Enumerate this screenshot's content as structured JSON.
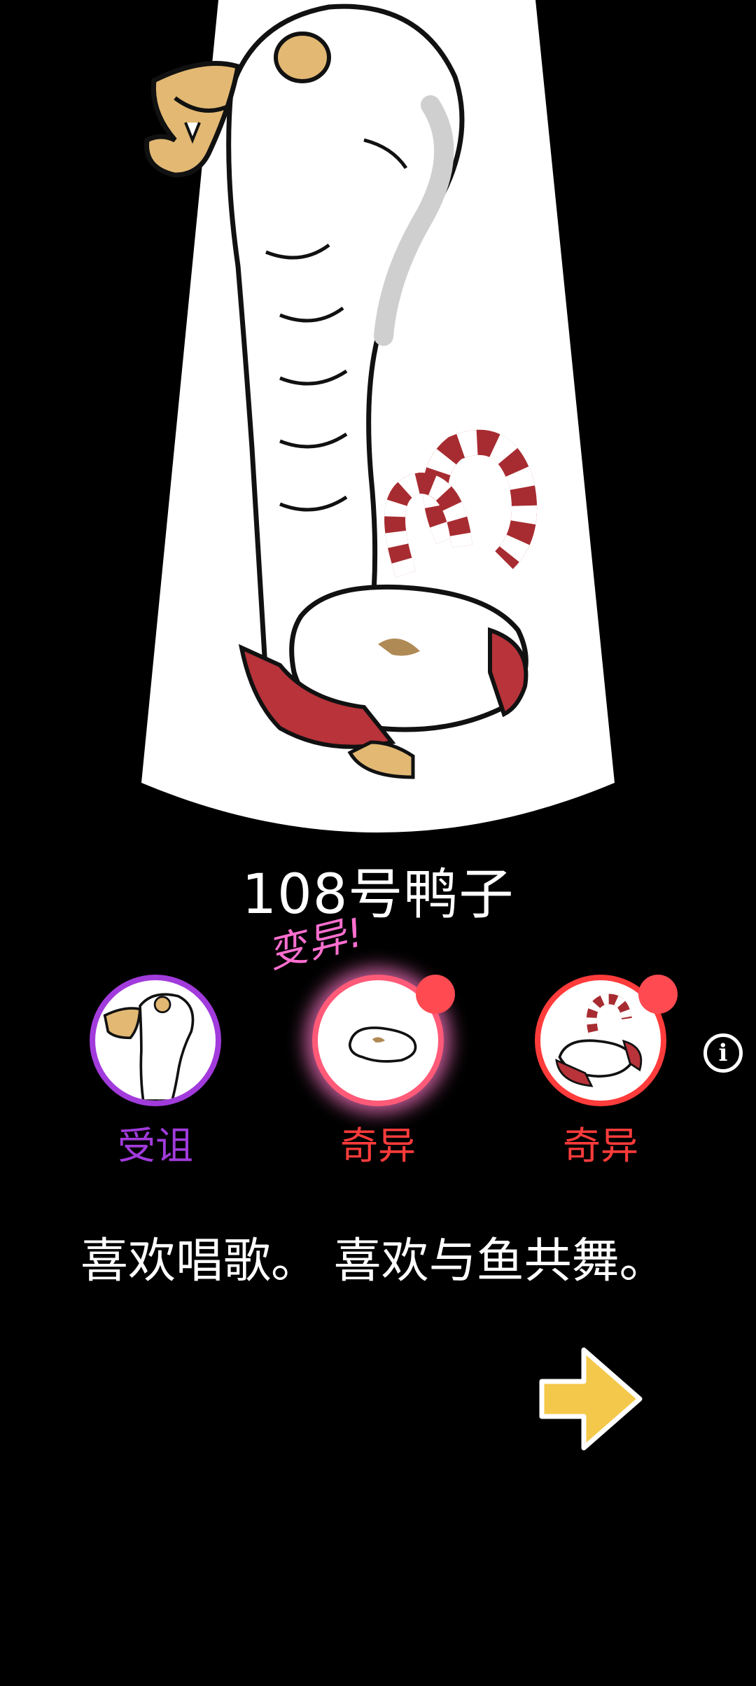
{
  "character": {
    "name": "108号鸭子",
    "mutation_label": "变异!",
    "description": "喜欢唱歌。 喜欢与鱼共舞。"
  },
  "traits": [
    {
      "label": "受诅",
      "color": "#a23bdc",
      "icon": "cursed-snake-neck-icon"
    },
    {
      "label": "奇异",
      "color": "#ff3b3b",
      "icon": "duck-body-icon",
      "glowing": true,
      "new": true
    },
    {
      "label": "奇异",
      "color": "#ff3b3b",
      "icon": "striped-tentacle-icon",
      "new": true
    }
  ],
  "icons": {
    "info": "info-icon",
    "next": "next-arrow-icon"
  },
  "colors": {
    "background": "#000000",
    "spotlight": "#ffffff",
    "cursed": "#a23bdc",
    "strange": "#ff3b3b",
    "mutation": "#ff6fd0",
    "arrow": "#f4c84a"
  }
}
